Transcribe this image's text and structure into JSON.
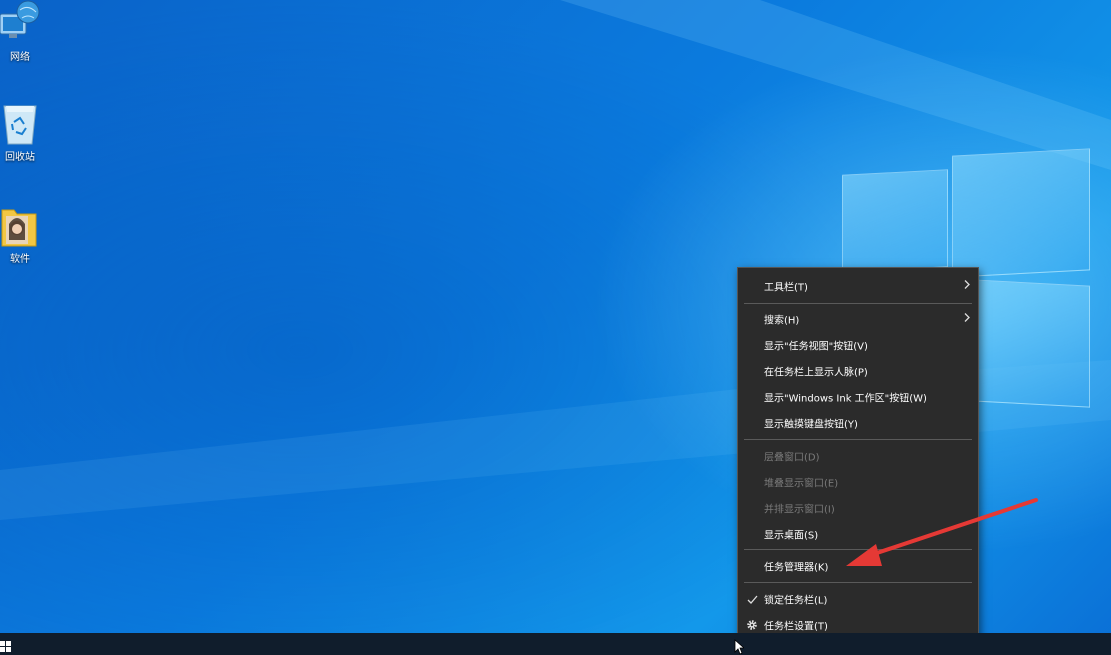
{
  "desktop": {
    "icons": [
      {
        "label": "网络",
        "icon": "network-icon"
      },
      {
        "label": "回收站",
        "icon": "recycle-bin-icon"
      },
      {
        "label": "软件",
        "icon": "folder-icon"
      }
    ]
  },
  "context_menu": {
    "items": [
      {
        "label": "工具栏(T)",
        "submenu": true
      },
      {
        "label": "搜索(H)",
        "submenu": true
      },
      {
        "label": "显示\"任务视图\"按钮(V)"
      },
      {
        "label": "在任务栏上显示人脉(P)"
      },
      {
        "label": "显示\"Windows Ink 工作区\"按钮(W)"
      },
      {
        "label": "显示触摸键盘按钮(Y)"
      },
      {
        "label": "层叠窗口(D)",
        "disabled": true
      },
      {
        "label": "堆叠显示窗口(E)",
        "disabled": true
      },
      {
        "label": "并排显示窗口(I)",
        "disabled": true
      },
      {
        "label": "显示桌面(S)"
      },
      {
        "label": "任务管理器(K)"
      },
      {
        "label": "锁定任务栏(L)",
        "checked": true
      },
      {
        "label": "任务栏设置(T)",
        "icon": "gear-icon"
      }
    ]
  },
  "annotation": {
    "color": "#e53935",
    "icon": "red-arrow-icon"
  },
  "colors": {
    "desktop_blue": "#0b7bde",
    "menu_bg": "#2b2b2b",
    "taskbar": "#101d2c"
  }
}
